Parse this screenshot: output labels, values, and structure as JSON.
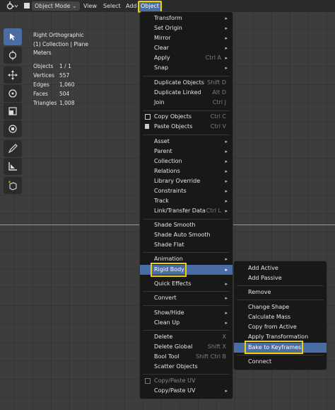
{
  "header": {
    "mode_label": "Object Mode",
    "menus": [
      "View",
      "Select",
      "Add",
      "Object"
    ]
  },
  "overlay": {
    "view_name": "Right Orthographic",
    "collection": "(1) Collection | Plane",
    "units": "Meters",
    "stats": [
      {
        "label": "Objects",
        "value": "1 / 1"
      },
      {
        "label": "Vertices",
        "value": "557"
      },
      {
        "label": "Edges",
        "value": "1,060"
      },
      {
        "label": "Faces",
        "value": "504"
      },
      {
        "label": "Triangles",
        "value": "1,008"
      }
    ]
  },
  "object_menu": {
    "items": [
      {
        "label": "Transform",
        "submenu": true
      },
      {
        "label": "Set Origin",
        "submenu": true
      },
      {
        "label": "Mirror",
        "submenu": true
      },
      {
        "label": "Clear",
        "submenu": true
      },
      {
        "label": "Apply",
        "shortcut": "Ctrl A",
        "submenu": true
      },
      {
        "label": "Snap",
        "submenu": true
      },
      {
        "label": "Duplicate Objects",
        "shortcut": "Shift D"
      },
      {
        "label": "Duplicate Linked",
        "shortcut": "Alt D"
      },
      {
        "label": "Join",
        "shortcut": "Ctrl J"
      },
      {
        "label": "Copy Objects",
        "shortcut": "Ctrl C"
      },
      {
        "label": "Paste Objects",
        "shortcut": "Ctrl V"
      },
      {
        "label": "Asset",
        "submenu": true
      },
      {
        "label": "Parent",
        "submenu": true
      },
      {
        "label": "Collection",
        "submenu": true
      },
      {
        "label": "Relations",
        "submenu": true
      },
      {
        "label": "Library Override",
        "submenu": true
      },
      {
        "label": "Constraints",
        "submenu": true
      },
      {
        "label": "Track",
        "submenu": true
      },
      {
        "label": "Link/Transfer Data",
        "shortcut": "Ctrl L",
        "submenu": true
      },
      {
        "label": "Shade Smooth"
      },
      {
        "label": "Shade Auto Smooth"
      },
      {
        "label": "Shade Flat"
      },
      {
        "label": "Animation",
        "submenu": true
      },
      {
        "label": "Rigid Body",
        "submenu": true
      },
      {
        "label": "Quick Effects",
        "submenu": true
      },
      {
        "label": "Convert",
        "submenu": true
      },
      {
        "label": "Show/Hide",
        "submenu": true
      },
      {
        "label": "Clean Up",
        "submenu": true
      },
      {
        "label": "Delete",
        "shortcut": "X"
      },
      {
        "label": "Delete Global",
        "shortcut": "Shift X"
      },
      {
        "label": "Bool Tool",
        "shortcut": "Shift Ctrl B"
      },
      {
        "label": "Scatter Objects"
      },
      {
        "label": "Copy/Paste UV"
      },
      {
        "label": "Copy/Paste UV",
        "submenu": true
      }
    ]
  },
  "rigid_body_menu": {
    "items": [
      {
        "label": "Add Active"
      },
      {
        "label": "Add Passive"
      },
      {
        "label": "Remove"
      },
      {
        "label": "Change Shape"
      },
      {
        "label": "Calculate Mass"
      },
      {
        "label": "Copy from Active"
      },
      {
        "label": "Apply Transformation"
      },
      {
        "label": "Bake to Keyframes"
      },
      {
        "label": "Connect"
      }
    ]
  },
  "colors": {
    "highlight": "#4a6da3",
    "annotation": "#f0d000",
    "axis_y": "#8ab12c"
  }
}
